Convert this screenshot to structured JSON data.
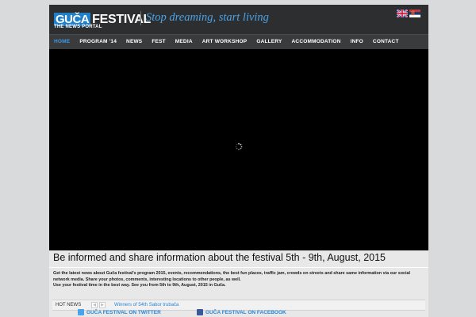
{
  "logo": {
    "brand_part1": "GUČA",
    "brand_part2": "FESTIVAL",
    "subtitle": "THE NEWS PORTAL"
  },
  "slogan": "Stop dreaming, start living",
  "languages": [
    {
      "icon": "uk-flag-icon"
    },
    {
      "icon": "serbia-flag-icon"
    }
  ],
  "nav": [
    {
      "label": "HOME",
      "active": true
    },
    {
      "label": "PROGRAM '14"
    },
    {
      "label": "NEWS"
    },
    {
      "label": "FEST"
    },
    {
      "label": "MEDIA"
    },
    {
      "label": "ART WORKSHOP"
    },
    {
      "label": "GALLERY"
    },
    {
      "label": "ACCOMMODATION"
    },
    {
      "label": "INFO"
    },
    {
      "label": "CONTACT"
    }
  ],
  "headline": "Be informed and share information about the festival 5th - 9th, August, 2015",
  "intro": {
    "line1": "Get the latest news about Guča festival's program 2015, events, recommendations, the best fun places, traffic jam, crowds on streets and share same information via our social network media. Share your photos, comments, interesting locations to other people, as well.",
    "line2": "Use your festival time in the best way. See you from 5th to 9th, August, 2015 in Guča."
  },
  "hot_news": {
    "label": "HOT NEWS",
    "item": "Winners of 54th Sabor trubača"
  },
  "social": {
    "twitter": "GUČA FESTIVAL ON TWITTER",
    "facebook": "GUČA FESTIVAL ON FACEBOOK"
  },
  "colors": {
    "accent": "#1f7fc9",
    "link": "#2a86d4",
    "header_bg": "#2d2e2f",
    "nav_bg": "#3a3b3c"
  }
}
